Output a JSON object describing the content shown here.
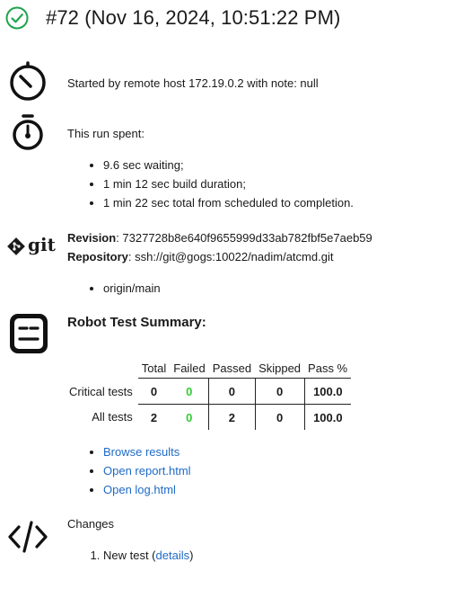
{
  "header": {
    "title": "#72 (Nov 16, 2024, 10:51:22 PM)",
    "status_icon": "check-circle-icon",
    "status_color": "#1ea44c"
  },
  "cause": {
    "icon": "timer-icon",
    "text": "Started by remote host 172.19.0.2 with note: null"
  },
  "timing": {
    "icon": "stopwatch-icon",
    "intro": "This run spent:",
    "items": [
      "9.6 sec waiting;",
      "1 min 12 sec build duration;",
      "1 min 22 sec total from scheduled to completion."
    ]
  },
  "git": {
    "icon": "git-logo-icon",
    "logo_text": "git",
    "revision_label": "Revision",
    "revision": ": 7327728b8e640f9655999d33ab782fbf5e7aeb59",
    "repository_label": "Repository",
    "repository": ": ssh://git@gogs:10022/nadim/atcmd.git",
    "branches": [
      "origin/main"
    ]
  },
  "robot": {
    "icon": "robot-icon",
    "title": "Robot Test Summary:",
    "columns": [
      "Total",
      "Failed",
      "Passed",
      "Skipped",
      "Pass %"
    ],
    "rows": [
      {
        "label": "Critical tests",
        "total": "0",
        "failed": "0",
        "passed": "0",
        "skipped": "0",
        "pass_pct": "100.0"
      },
      {
        "label": "All tests",
        "total": "2",
        "failed": "0",
        "passed": "2",
        "skipped": "0",
        "pass_pct": "100.0"
      }
    ],
    "failed_color": "#33cc33",
    "links": [
      "Browse results",
      "Open report.html",
      "Open log.html"
    ]
  },
  "changes": {
    "icon": "code-icon",
    "title": "Changes",
    "item_text": "New test (",
    "item_link": "details",
    "item_suffix": ")"
  }
}
